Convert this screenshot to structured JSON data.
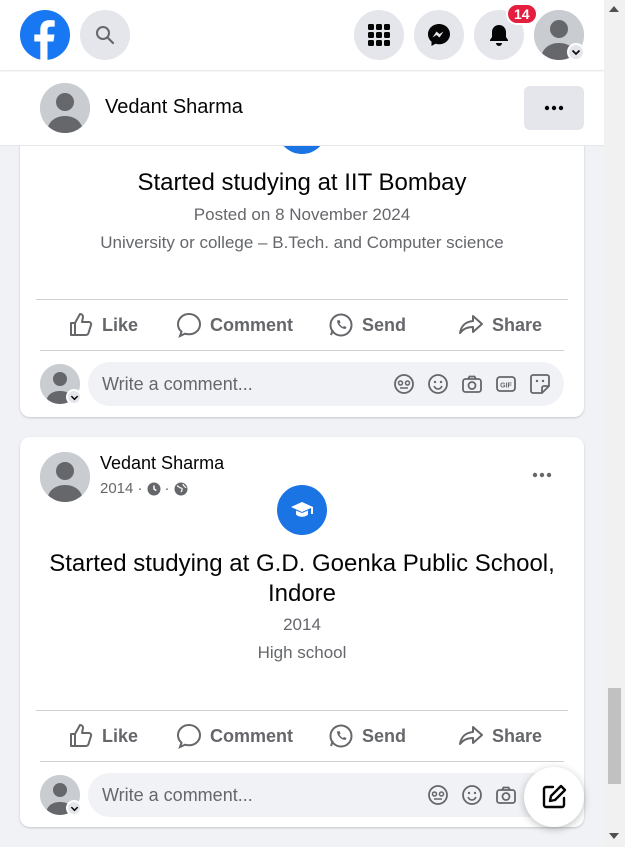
{
  "topnav": {
    "notification_count": "14",
    "colors": {
      "brand": "#1877f2",
      "badge": "#e41e3f"
    }
  },
  "profile_header": {
    "name": "Vedant Sharma"
  },
  "posts": [
    {
      "title": "Started studying at IIT Bombay",
      "line1": "Posted on 8 November 2024",
      "line2": "University or college – B.Tech. and Computer science",
      "actions": {
        "like": "Like",
        "comment": "Comment",
        "send": "Send",
        "share": "Share"
      },
      "comment_placeholder": "Write a comment..."
    },
    {
      "author": "Vedant Sharma",
      "year_meta": "2014 ·",
      "title": "Started studying at G.D. Goenka Public School, Indore",
      "line1": "2014",
      "line2": "High school",
      "actions": {
        "like": "Like",
        "comment": "Comment",
        "send": "Send",
        "share": "Share"
      },
      "comment_placeholder": "Write a comment..."
    }
  ]
}
